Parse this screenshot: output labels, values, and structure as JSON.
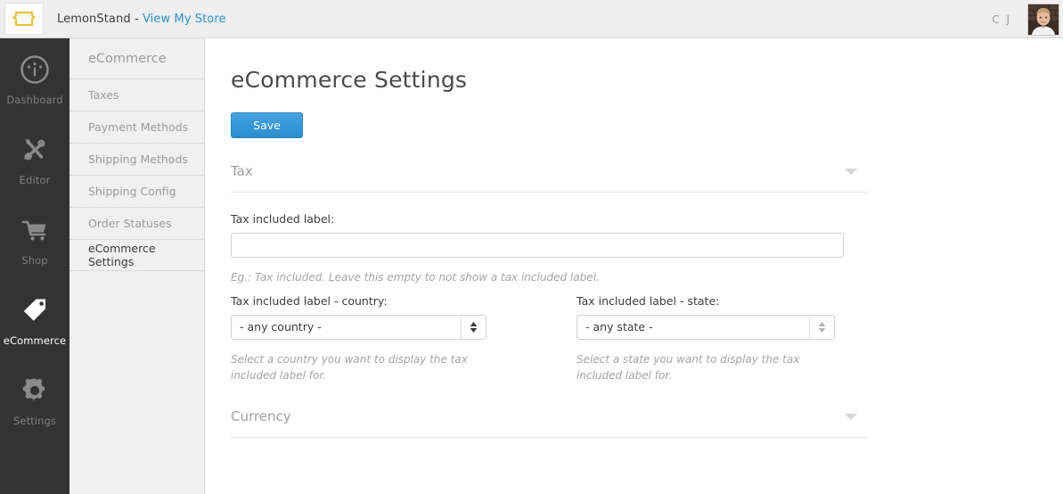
{
  "topbar": {
    "logo_icon": "lemonstand-tag-logo",
    "logo_color": "#e8c13c",
    "brand_name": "LemonStand - ",
    "store_link": "View My Store",
    "store_link_color": "#2f8fd0",
    "user_initials": "C J",
    "avatar_icon": "user-avatar-photo"
  },
  "sidebar": {
    "items": [
      {
        "label": "Dashboard",
        "icon": "dashboard-gauge-icon",
        "active": false
      },
      {
        "label": "Editor",
        "icon": "editor-tools-icon",
        "active": false
      },
      {
        "label": "Shop",
        "icon": "shop-cart-icon",
        "active": false
      },
      {
        "label": "eCommerce",
        "icon": "ecommerce-tag-icon",
        "active": true
      },
      {
        "label": "Settings",
        "icon": "settings-gear-icon",
        "active": false
      }
    ]
  },
  "subnav": {
    "title": "eCommerce",
    "items": [
      {
        "label": "Taxes",
        "active": false
      },
      {
        "label": "Payment Methods",
        "active": false
      },
      {
        "label": "Shipping Methods",
        "active": false
      },
      {
        "label": "Shipping Config",
        "active": false
      },
      {
        "label": "Order Statuses",
        "active": false
      },
      {
        "label": "eCommerce Settings",
        "active": true
      }
    ]
  },
  "main": {
    "page_title": "eCommerce Settings",
    "save_label": "Save",
    "save_color": "#3498db",
    "sections": {
      "tax": {
        "title": "Tax",
        "toggle_icon": "chevron-down-icon",
        "tax_included_label": {
          "label": "Tax included label:",
          "value": "",
          "placeholder": "",
          "hint": "Eg.: Tax included. Leave this empty to not show a tax included label."
        },
        "country": {
          "label": "Tax included label - country:",
          "value": "- any country -",
          "hint": "Select a country you want to display the tax included label for.",
          "arrow_icon": "select-updown-arrow-icon"
        },
        "state": {
          "label": "Tax included label - state:",
          "value": "- any state -",
          "hint": "Select a state you want to display the tax included label for.",
          "arrow_icon": "select-updown-arrow-icon"
        }
      },
      "currency": {
        "title": "Currency",
        "toggle_icon": "chevron-down-icon"
      }
    }
  }
}
